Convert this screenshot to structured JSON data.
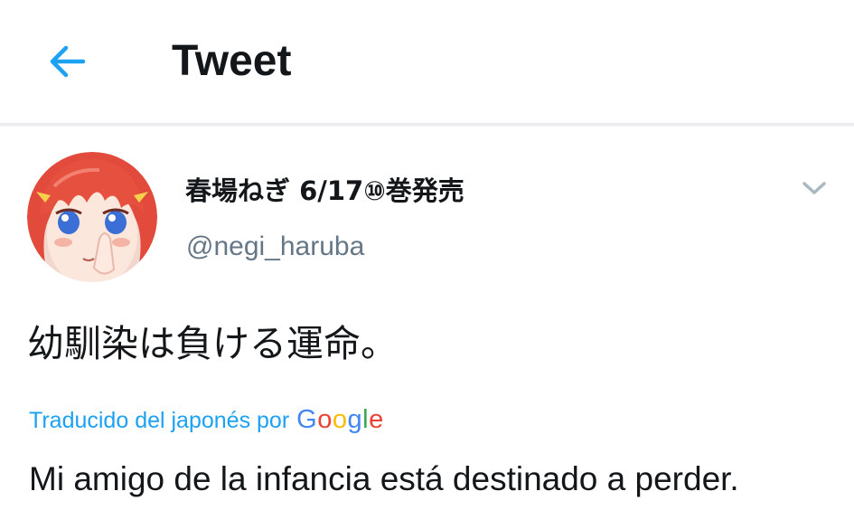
{
  "header": {
    "title": "Tweet",
    "back_icon": "arrow-left-icon"
  },
  "tweet": {
    "display_name": "春場ねぎ 6/17⑩巻発売",
    "handle": "@negi_haruba",
    "text": "幼馴染は負ける運命。",
    "translation_label": "Traducido del japonés por",
    "translation_provider": "Google",
    "translated_text": "Mi amigo de la infancia está destinado a perder.",
    "menu_icon": "chevron-down-icon"
  },
  "colors": {
    "accent": "#1da1f2",
    "text_primary": "#14171a",
    "text_secondary": "#657786",
    "divider": "#e6e8ea",
    "google_blue": "#4285f4",
    "google_red": "#ea4335",
    "google_yellow": "#fbbc05",
    "google_green": "#34a853"
  }
}
